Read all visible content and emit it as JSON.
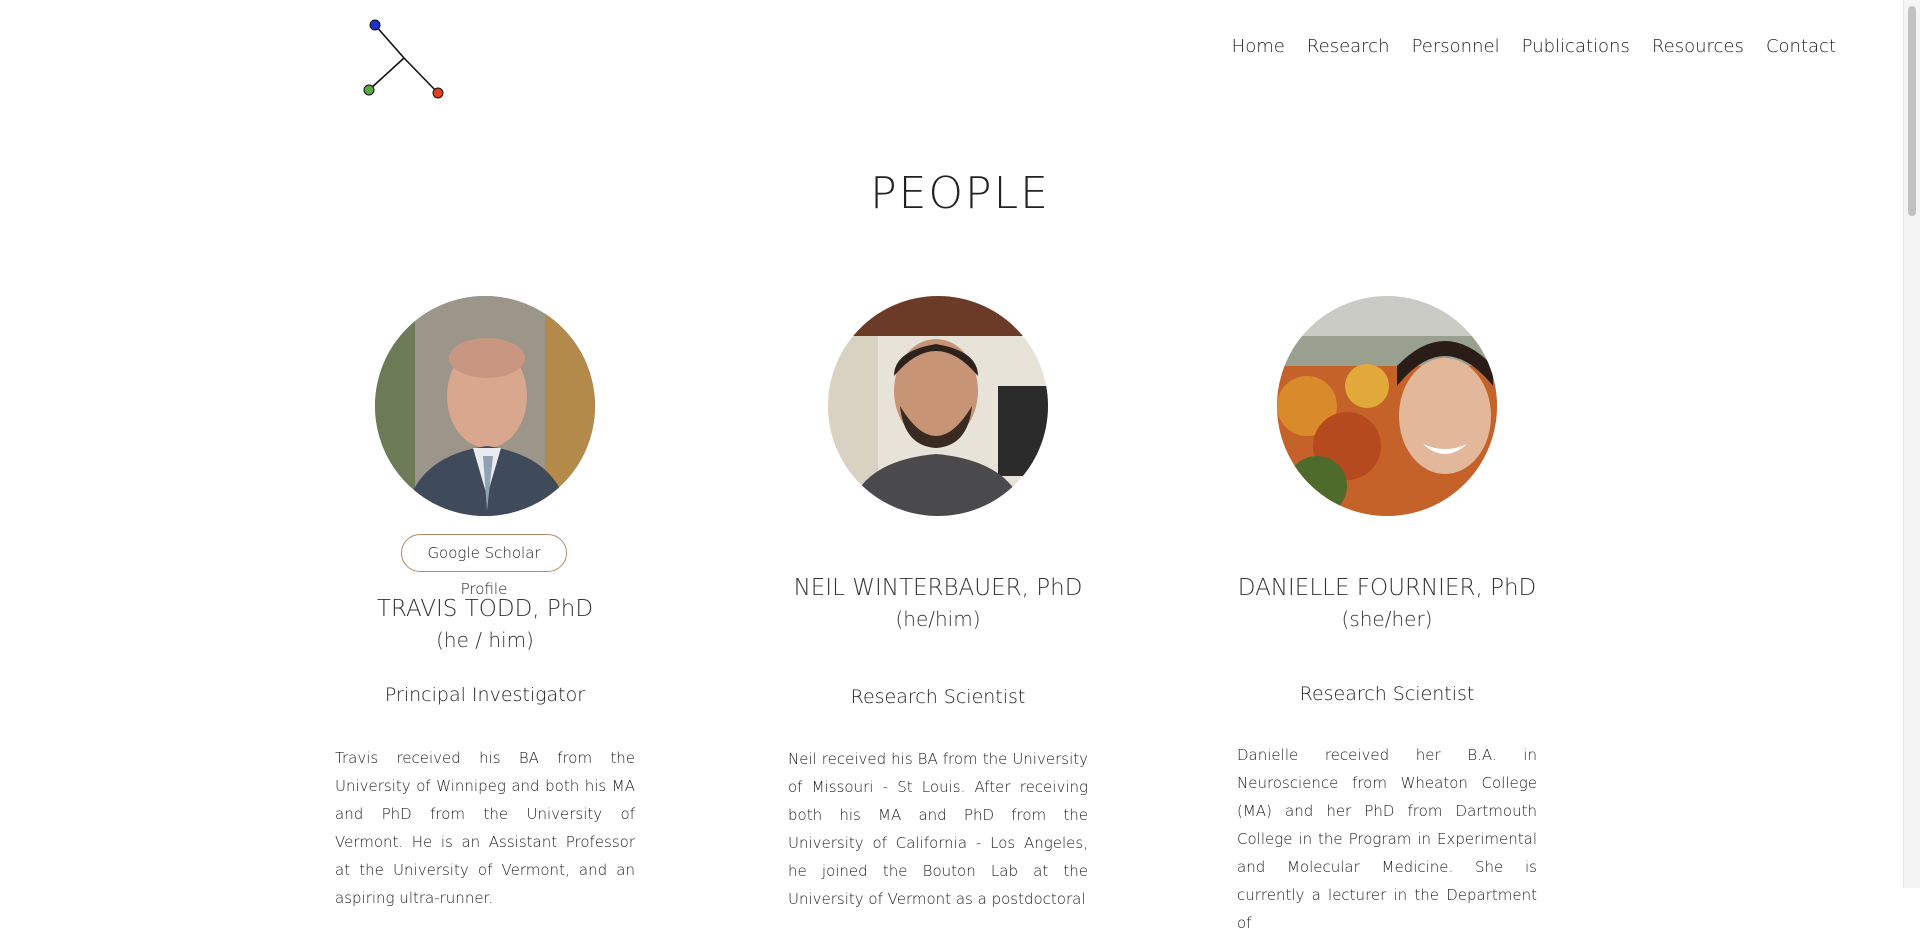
{
  "nav": {
    "items": [
      {
        "label": "Home"
      },
      {
        "label": "Research"
      },
      {
        "label": "Personnel"
      },
      {
        "label": "Publications"
      },
      {
        "label": "Resources"
      },
      {
        "label": "Contact"
      }
    ]
  },
  "page": {
    "title": "PEOPLE"
  },
  "colors": {
    "accent_border": "#b58a6a",
    "logo_blue": "#1f2fd1",
    "logo_green": "#5aa84a",
    "logo_red": "#e0431b"
  },
  "people": [
    {
      "name": "TRAVIS TODD, PhD",
      "pronouns": "(he / him)",
      "role": "Principal Investigator",
      "scholar_label": "Google Scholar Profile",
      "bio": "Travis received his BA from the University of Winnipeg and both his MA and PhD from the University of Vermont. He is an Assistant Professor at the University of Vermont, and an aspiring ultra-runner."
    },
    {
      "name": "NEIL WINTERBAUER, PhD",
      "pronouns": "(he/him)",
      "role": "Research Scientist",
      "bio": "Neil received his BA from the University of Missouri - St Louis. After receiving both his MA and PhD from the University of California - Los Angeles, he joined the Bouton Lab at the University of Vermont as a postdoctoral"
    },
    {
      "name": "DANIELLE FOURNIER, PhD",
      "pronouns": "(she/her)",
      "role": "Research Scientist",
      "bio": "Danielle received her B.A. in Neuroscience from Wheaton College (MA) and her PhD from Dartmouth College in the Program in Experimental and Molecular Medicine. She is currently a lecturer in the Department of"
    }
  ]
}
